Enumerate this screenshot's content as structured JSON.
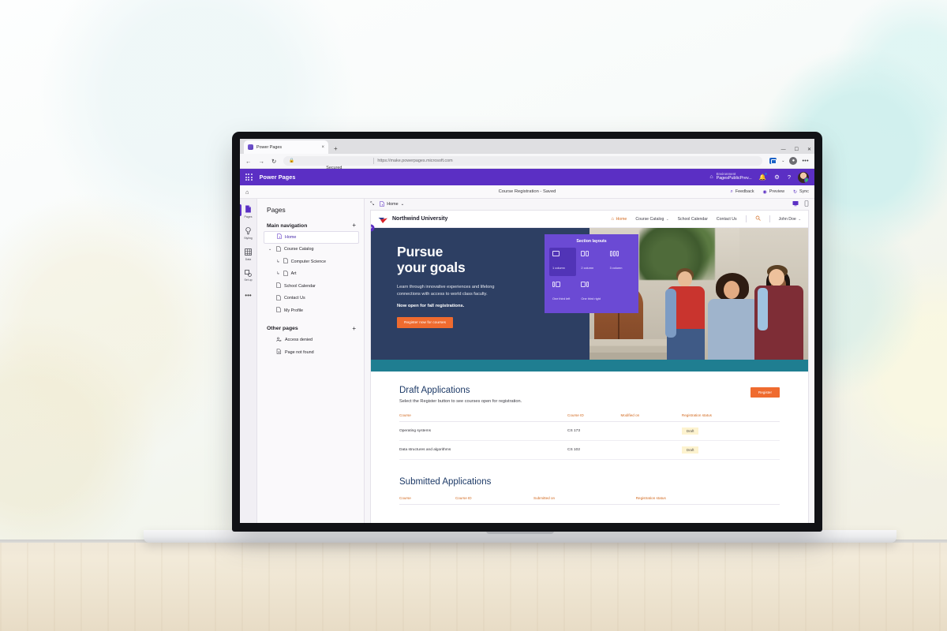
{
  "browser": {
    "tab_title": "Power Pages",
    "tab_close": "×",
    "new_tab": "+",
    "back": "←",
    "forward": "→",
    "reload": "↻",
    "lock_icon": "🔒",
    "security_label": "Secured",
    "url": "https://make.powerpages.microsoft.com",
    "minimize": "—",
    "maximize": "☐",
    "close": "✕",
    "profile_initial": "●",
    "more_menu": "•••",
    "collections_chevron": "⌄"
  },
  "appbar": {
    "waffle_icon": "waffle-icon",
    "product_name": "Power Pages",
    "environment_label": "Environment",
    "environment_value": "PagesPublicPrev...",
    "env_icon": "⌂",
    "notifications_icon": "🔔",
    "settings_icon": "⚙",
    "help_icon": "?",
    "avatar": "avatar"
  },
  "commandbar": {
    "home_icon": "⌂",
    "status_title": "Course Registration - Saved",
    "feedback_icon": "⌕",
    "feedback_label": "Feedback",
    "preview_icon": "◉",
    "preview_label": "Preview",
    "sync_icon": "↻",
    "sync_label": "Sync"
  },
  "rail": {
    "items": [
      {
        "icon": "὜b",
        "label": "Pages",
        "active": true
      },
      {
        "icon": "✒",
        "label": "Styling",
        "active": false
      },
      {
        "icon": "▦",
        "label": "Data",
        "active": false
      },
      {
        "icon": "⚙",
        "label": "Set up",
        "active": false
      }
    ],
    "more": "•••"
  },
  "pages_panel": {
    "title": "Pages",
    "main_nav": {
      "label": "Main navigation",
      "add": "+"
    },
    "main_items": [
      {
        "label": "Home",
        "icon": "page-icon",
        "selected": true,
        "child": false,
        "expander": ""
      },
      {
        "label": "Course Catalog",
        "icon": "page-icon",
        "selected": false,
        "child": false,
        "expander": "⌄"
      },
      {
        "label": "Computer Science",
        "icon": "page-icon",
        "selected": false,
        "child": true,
        "expander": "↳"
      },
      {
        "label": "Art",
        "icon": "page-icon",
        "selected": false,
        "child": true,
        "expander": "↳"
      },
      {
        "label": "School Calendar",
        "icon": "page-icon",
        "selected": false,
        "child": false,
        "expander": ""
      },
      {
        "label": "Contact Us",
        "icon": "page-icon",
        "selected": false,
        "child": false,
        "expander": ""
      },
      {
        "label": "My Profile",
        "icon": "page-icon",
        "selected": false,
        "child": false,
        "expander": ""
      }
    ],
    "other_pages": {
      "label": "Other pages",
      "add": "+"
    },
    "other_items": [
      {
        "label": "Access denied",
        "icon": "access-denied-icon"
      },
      {
        "label": "Page not found",
        "icon": "page-not-found-icon"
      }
    ]
  },
  "canvas_toolbar": {
    "expand_icon": "⤡",
    "breadcrumb_page": "Home",
    "breadcrumb_caret": "⌄",
    "desktop_icon": "🖥",
    "mobile_icon": "📱"
  },
  "site": {
    "brand": "Northwind University",
    "nav": [
      {
        "label": "Home",
        "current": true,
        "caret": "",
        "icon": "⌂"
      },
      {
        "label": "Course Catalog",
        "current": false,
        "caret": "⌄",
        "icon": ""
      },
      {
        "label": "School Calendar",
        "current": false,
        "caret": "",
        "icon": ""
      },
      {
        "label": "Contact Us",
        "current": false,
        "caret": "",
        "icon": ""
      }
    ],
    "search_icon": "🔍",
    "user_name": "John Doe",
    "user_caret": "⌄",
    "hero": {
      "title_line1": "Pursue",
      "title_line2": "your goals",
      "subtitle": "Learn through innovative experiences and lifelong connections with access to world class faculty.",
      "emphasis": "Now open for fall registrations.",
      "cta": "Register now for courses"
    },
    "add_section_plus": "+",
    "draft": {
      "heading": "Draft Applications",
      "lead": "Select the Register button to see courses open for registration.",
      "register_button": "Register",
      "columns": [
        "Course",
        "Course ID",
        "Modified on",
        "Registration status"
      ],
      "rows": [
        {
          "course": "Operating systems",
          "course_id": "CS 173",
          "modified_on": "",
          "status": "Draft"
        },
        {
          "course": "Data structures and algorithms",
          "course_id": "CS 102",
          "modified_on": "",
          "status": "Draft"
        }
      ]
    },
    "submitted": {
      "heading": "Submitted Applications",
      "columns": [
        "Course",
        "Course ID",
        "Submitted on",
        "Registration status"
      ]
    }
  },
  "layouts_flyout": {
    "title": "Section layouts",
    "options": [
      {
        "label": "1 column",
        "cols": 1,
        "selected": true
      },
      {
        "label": "2 column",
        "cols": 2,
        "selected": false
      },
      {
        "label": "3 column",
        "cols": 3,
        "selected": false
      },
      {
        "label": "One third left",
        "cols": 2,
        "selected": false
      },
      {
        "label": "One third right",
        "cols": 2,
        "selected": false
      }
    ]
  },
  "colors": {
    "power_pages_purple": "#5b2fc4",
    "flyout_purple": "#6b4ad4",
    "hero_navy": "#2d3f63",
    "teal_band": "#1f7e91",
    "accent_orange": "#ef6b2f",
    "table_header_orange": "#d2691e",
    "status_draft_bg": "#fdf3cf"
  }
}
